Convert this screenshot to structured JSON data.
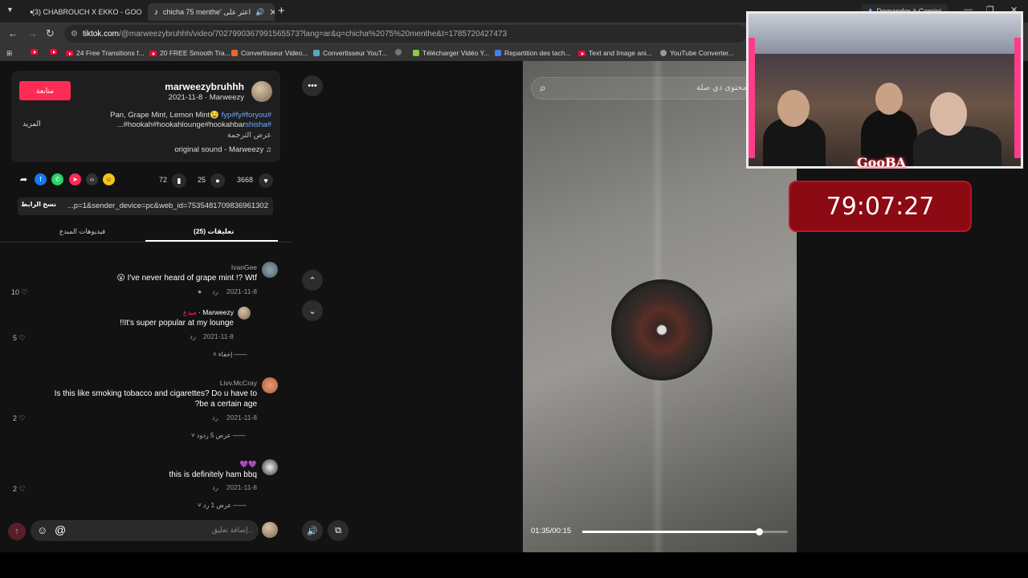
{
  "browser": {
    "tabs": [
      {
        "title": "(3) CHABROUCH X EKKO - GOO"
      },
      {
        "title": "chicha 75 menthe' اعثر على"
      }
    ],
    "gemini_button": "Demander à Gemini",
    "url_host": "tiktok.com",
    "url_path": "/@marweezybruhhh/video/7027990367991565573?lang=ar&q=chicha%2075%20menthe&t=1785720427473",
    "bookmarks": [
      "24 Free Transitions f...",
      "20 FREE Smooth Tra...",
      "Convertisseur Video...",
      "Convertisseur YouT...",
      "Télécharger Vidéo Y...",
      "Repartition des tach...",
      "Text and Image ani...",
      "YouTube Converter..."
    ]
  },
  "post": {
    "follow_label": "متابعة",
    "username": "marweezybruhhh",
    "subline": "2021-11-8 · Marweezy",
    "desc_line1_plain": "Pan, Grape Mint, Lemon Mint🤤 ",
    "desc_line1_tags": "fyp#fy#foryou#",
    "desc_line2_plain": "...#hookah#hookahlounge#hookahbar",
    "desc_line2_tag": "shisha#",
    "more_label": "المزيد",
    "translate_label": "عرض الترجمة",
    "sound": "original sound - Marweezy",
    "likes": "3668",
    "comments": "25",
    "saves": "72",
    "copy_link_label": "نسخ الرابط",
    "link_text": "...p=1&sender_device=pc&web_id=7535481709836961302"
  },
  "tabs": {
    "comments": "(25) تعليقات",
    "creator_videos": "فيديوهات المبدع"
  },
  "comments": [
    {
      "name": "IvanGee",
      "text": "😮 I've never heard of grape mint !? Wtf",
      "date": "2021-11-8",
      "reply": "رد",
      "likes": "10"
    },
    {
      "name": "Marweezy · مبدع",
      "text": "!!It's super popular at my lounge",
      "date": "2021-11-8",
      "reply": "رد",
      "likes": "5",
      "hide": "إخفاء"
    },
    {
      "name": "Livv.McCray",
      "text": "Is this like smoking tobacco and cigarettes? Do u have to",
      "text2": "?be a certain age",
      "date": "2021-11-8",
      "reply": "رد",
      "likes": "2",
      "view_replies": "عرض 5 ردود"
    },
    {
      "name": "💜💜",
      "text": "this is definitely ham bbq",
      "date": "2021-11-8",
      "reply": "رد",
      "likes": "2",
      "view_replies": "عرض 1 رد"
    }
  ],
  "input": {
    "placeholder": "إضافة تعليق..."
  },
  "video": {
    "search_placeholder": "محتوى ذي صلة",
    "time": "01:35/00:15",
    "progress": 0.86
  },
  "overlay": {
    "brand": "GooBA",
    "timer": "79:07:27"
  },
  "icons": {
    "share": "share-arrow-icon",
    "facebook": "facebook-icon",
    "whatsapp": "whatsapp-icon",
    "telegram": "telegram-icon",
    "embed": "embed-code-icon",
    "smile": "smile-face-icon"
  },
  "colors": {
    "accent": "#fe2c55",
    "link": "#6ea8ff",
    "timer_bg": "#8c0a13"
  }
}
